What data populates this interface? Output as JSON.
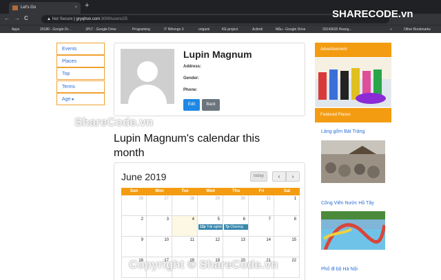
{
  "browser": {
    "tab_title": "Let's Go",
    "tab_close": "×",
    "new_tab": "+",
    "nav_back": "←",
    "nav_forward": "→",
    "nav_reload": "C",
    "security_label": "Not Secure",
    "url_host": "gryqhon.com",
    "url_path": ":3000/users/25",
    "bookmarks": [
      "Apps",
      "20180 - Google Dr...",
      "JPLT - Google Drive",
      "Programing",
      "IT Nihongo 3",
      "origami",
      "KE-project",
      "Actindi",
      "Mẫu - Google Drive",
      "20143635 Hoang...",
      "»",
      "Other Bookmarks"
    ]
  },
  "sidebar": {
    "items": [
      "Events",
      "Places",
      "Top",
      "Terms",
      "Age ▸"
    ]
  },
  "profile": {
    "name": "Lupin Magnum",
    "address_label": "Address:",
    "gender_label": "Gender:",
    "phone_label": "Phone:",
    "edit_button": "Edit",
    "back_button": "Back"
  },
  "calendar": {
    "heading": "Lupin Magnum's calendar this month",
    "month_label": "June 2019",
    "today_button": "today",
    "prev": "‹",
    "next": "›",
    "days": [
      "Sun",
      "Mon",
      "Tue",
      "Wed",
      "Thu",
      "Fri",
      "Sat"
    ],
    "weeks": [
      [
        "26",
        "27",
        "28",
        "29",
        "30",
        "31",
        "1"
      ],
      [
        "2",
        "3",
        "4",
        "5",
        "6",
        "7",
        "8"
      ],
      [
        "9",
        "10",
        "11",
        "12",
        "13",
        "14",
        "15"
      ],
      [
        "16",
        "17",
        "18",
        "19",
        "20",
        "21",
        "22"
      ]
    ],
    "events": [
      {
        "time": "12p",
        "title": "Trải nghiệ"
      },
      {
        "time": "7p",
        "title": "Chương"
      }
    ]
  },
  "right": {
    "ad_header": "Advertisement",
    "featured_header": "Featured Places",
    "places": [
      "Làng gốm Bát Tràng",
      "Công Viên Nước Hồ Tây",
      "Phố đi bộ Hà Nội"
    ]
  },
  "watermark": {
    "logo": "SHARECODE.vn",
    "center": "ShareCode.vn",
    "bottom": "Copyright © ShareCode.vn"
  },
  "colors": {
    "accent": "#f39c12",
    "link": "#2a6fd6",
    "button": "#1e88e5",
    "event": "#3a87ad"
  }
}
